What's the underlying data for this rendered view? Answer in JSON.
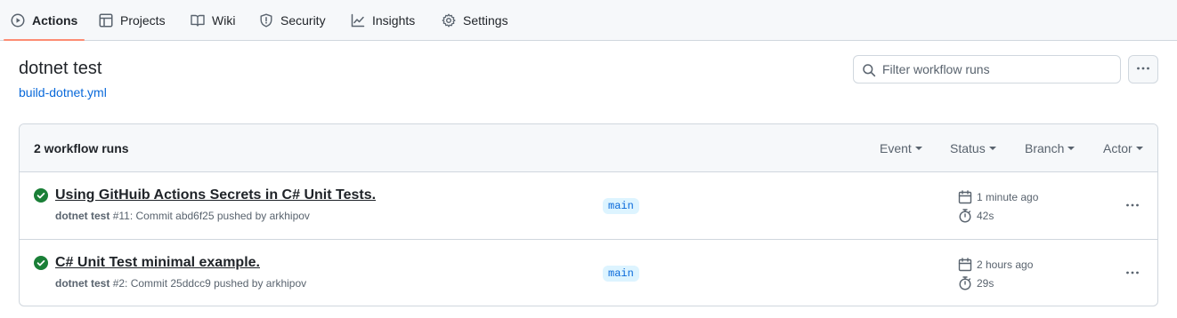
{
  "nav": {
    "tabs": [
      {
        "label": "Actions",
        "icon": "play-icon",
        "active": true
      },
      {
        "label": "Projects",
        "icon": "table-icon"
      },
      {
        "label": "Wiki",
        "icon": "book-icon"
      },
      {
        "label": "Security",
        "icon": "shield-icon"
      },
      {
        "label": "Insights",
        "icon": "graph-icon"
      },
      {
        "label": "Settings",
        "icon": "gear-icon"
      }
    ]
  },
  "workflow": {
    "title": "dotnet test",
    "file": "build-dotnet.yml"
  },
  "filter": {
    "placeholder": "Filter workflow runs",
    "value": ""
  },
  "runs": {
    "count_label": "2 workflow runs",
    "filters": [
      "Event",
      "Status",
      "Branch",
      "Actor"
    ],
    "items": [
      {
        "title": "Using GitHuib Actions Secrets in C# Unit Tests.",
        "workflow": "dotnet test",
        "detail": "#11: Commit abd6f25 pushed by arkhipov",
        "branch": "main",
        "time": "1 minute ago",
        "duration": "42s",
        "status": "success"
      },
      {
        "title": "C# Unit Test minimal example.",
        "workflow": "dotnet test",
        "detail": "#2: Commit 25ddcc9 pushed by arkhipov",
        "branch": "main",
        "time": "2 hours ago",
        "duration": "29s",
        "status": "success"
      }
    ]
  },
  "colors": {
    "accent_underline": "#fd8c73",
    "link": "#0969da",
    "success": "#1a7f37",
    "branch_bg": "#ddf4ff"
  }
}
